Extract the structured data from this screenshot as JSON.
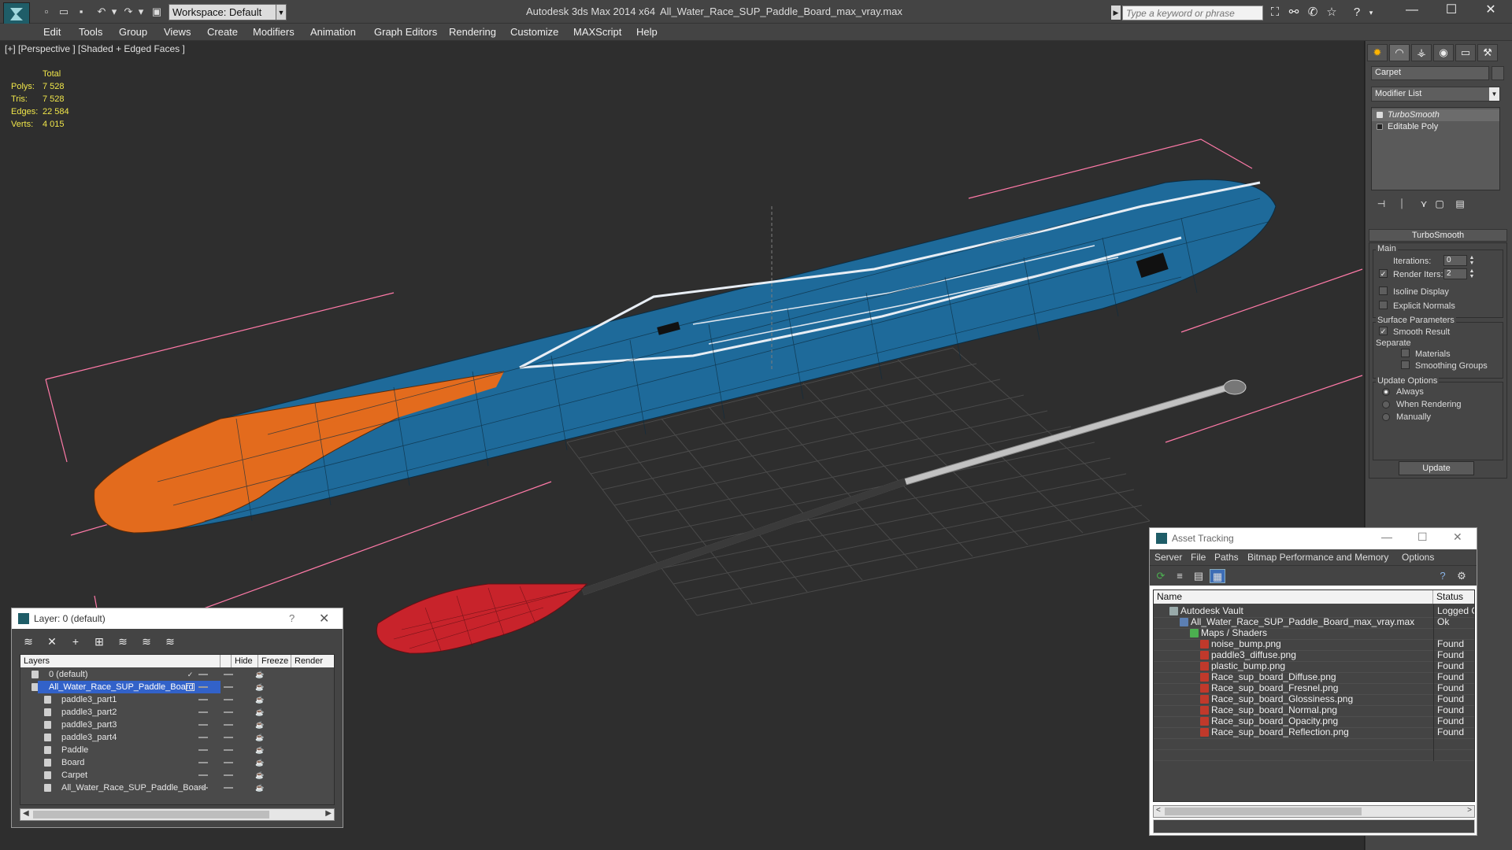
{
  "titlebar": {
    "app_title": "Autodesk 3ds Max  2014 x64",
    "file_title": "All_Water_Race_SUP_Paddle_Board_max_vray.max",
    "workspace": "Workspace: Default",
    "search_placeholder": "Type a keyword or phrase",
    "minimize": "—",
    "maximize": "☐",
    "close": "✕"
  },
  "menu": [
    "Edit",
    "Tools",
    "Group",
    "Views",
    "Create",
    "Modifiers",
    "Animation",
    "Graph Editors",
    "Rendering",
    "Customize",
    "MAXScript",
    "Help"
  ],
  "viewport": {
    "label": "[+] [Perspective ] [Shaded + Edged Faces ]",
    "stats": {
      "header": "Total",
      "rows": [
        {
          "k": "Polys:",
          "v": "7 528"
        },
        {
          "k": "Tris:",
          "v": "7 528"
        },
        {
          "k": "Edges:",
          "v": "22 584"
        },
        {
          "k": "Verts:",
          "v": "4 015"
        }
      ]
    }
  },
  "command_panel": {
    "object_name": "Carpet",
    "modifier_list": "Modifier List",
    "stack": [
      "TurboSmooth",
      "Editable Poly"
    ],
    "rollout_title": "TurboSmooth",
    "main_group": "Main",
    "iterations_label": "Iterations:",
    "iterations_value": "0",
    "render_iters_label": "Render Iters:",
    "render_iters_value": "2",
    "render_iters_checked": true,
    "isoline": "Isoline Display",
    "explicit_normals": "Explicit Normals",
    "surface_group": "Surface Parameters",
    "smooth_result": "Smooth Result",
    "separate": "Separate",
    "materials": "Materials",
    "smoothing_groups": "Smoothing Groups",
    "update_group": "Update Options",
    "always": "Always",
    "when_rendering": "When Rendering",
    "manually": "Manually",
    "update_button": "Update"
  },
  "layer_dialog": {
    "title": "Layer: 0 (default)",
    "help": "?",
    "close": "✕",
    "columns": [
      "Layers",
      "Hide",
      "Freeze",
      "Render"
    ],
    "rows": [
      {
        "name": "0 (default)",
        "level": 0,
        "selected": false
      },
      {
        "name": "All_Water_Race_SUP_Paddle_Board",
        "level": 0,
        "selected": true
      },
      {
        "name": "paddle3_part1",
        "level": 1,
        "selected": false
      },
      {
        "name": "paddle3_part2",
        "level": 1,
        "selected": false
      },
      {
        "name": "paddle3_part3",
        "level": 1,
        "selected": false
      },
      {
        "name": "paddle3_part4",
        "level": 1,
        "selected": false
      },
      {
        "name": "Paddle",
        "level": 1,
        "selected": false
      },
      {
        "name": "Board",
        "level": 1,
        "selected": false
      },
      {
        "name": "Carpet",
        "level": 1,
        "selected": false
      },
      {
        "name": "All_Water_Race_SUP_Paddle_Board",
        "level": 1,
        "selected": false
      }
    ]
  },
  "asset_dialog": {
    "title": "Asset Tracking",
    "menu": [
      "Server",
      "File",
      "Paths",
      "Bitmap Performance and Memory",
      "Options"
    ],
    "columns": [
      "Name",
      "Status"
    ],
    "rows": [
      {
        "name": "Autodesk Vault",
        "status": "Logged O",
        "level": 0,
        "icon": "vault-icon"
      },
      {
        "name": "All_Water_Race_SUP_Paddle_Board_max_vray.max",
        "status": "Ok",
        "level": 1,
        "icon": "max-file-icon"
      },
      {
        "name": "Maps / Shaders",
        "status": "",
        "level": 2,
        "icon": "maps-folder-icon"
      },
      {
        "name": "noise_bump.png",
        "status": "Found",
        "level": 3,
        "icon": "png-icon"
      },
      {
        "name": "paddle3_diffuse.png",
        "status": "Found",
        "level": 3,
        "icon": "png-icon"
      },
      {
        "name": "plastic_bump.png",
        "status": "Found",
        "level": 3,
        "icon": "png-icon"
      },
      {
        "name": "Race_sup_board_Diffuse.png",
        "status": "Found",
        "level": 3,
        "icon": "png-icon"
      },
      {
        "name": "Race_sup_board_Fresnel.png",
        "status": "Found",
        "level": 3,
        "icon": "png-icon"
      },
      {
        "name": "Race_sup_board_Glossiness.png",
        "status": "Found",
        "level": 3,
        "icon": "png-icon"
      },
      {
        "name": "Race_sup_board_Normal.png",
        "status": "Found",
        "level": 3,
        "icon": "png-icon"
      },
      {
        "name": "Race_sup_board_Opacity.png",
        "status": "Found",
        "level": 3,
        "icon": "png-icon"
      },
      {
        "name": "Race_sup_board_Reflection.png",
        "status": "Found",
        "level": 3,
        "icon": "png-icon"
      }
    ]
  },
  "colors": {
    "board_blue": "#1e6a9a",
    "board_orange": "#e36b1d",
    "paddle_red": "#c8232b",
    "bbox_pink": "#ff7aa8",
    "stats_yellow": "#f0e64a",
    "selection_blue": "#3262c9"
  }
}
